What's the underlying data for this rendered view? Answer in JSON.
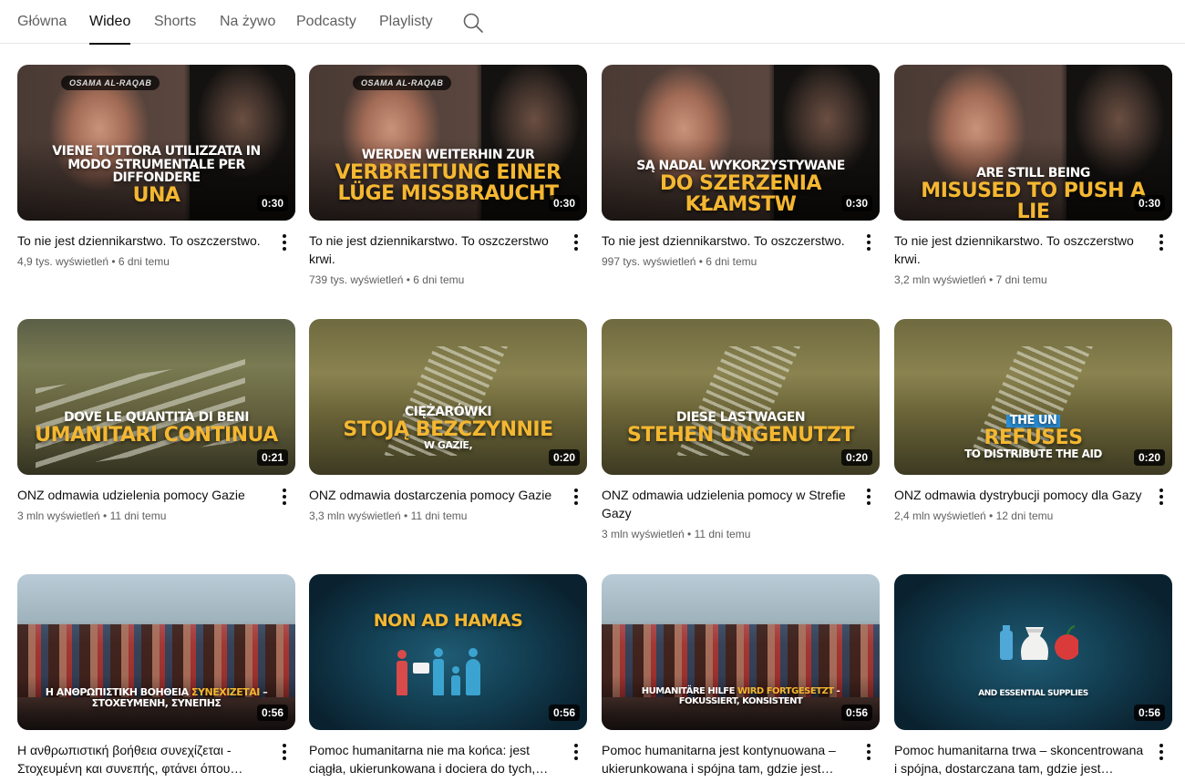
{
  "tabs": [
    {
      "label": "Główna",
      "active": false
    },
    {
      "label": "Wideo",
      "active": true
    },
    {
      "label": "Shorts",
      "active": false
    },
    {
      "label": "Na żywo",
      "active": false
    },
    {
      "label": "Podcasty",
      "active": false
    },
    {
      "label": "Playlisty",
      "active": false
    }
  ],
  "videos": [
    {
      "title": "To nie jest dziennikarstwo. To oszczerstwo.",
      "views": "4,9 tys. wyświetleń",
      "age": "6 dni temu",
      "duration": "0:30",
      "tag": "OSAMA AL-RAQAB",
      "cap_white": "VIENE TUTTORA UTILIZZATA IN MODO STRUMENTALE PER DIFFONDERE",
      "cap_yellow": "UNA"
    },
    {
      "title": "To nie jest dziennikarstwo. To oszczerstwo krwi.",
      "views": "739 tys. wyświetleń",
      "age": "6 dni temu",
      "duration": "0:30",
      "tag": "OSAMA AL-RAQAB",
      "cap_white": "WERDEN WEITERHIN ZUR",
      "cap_yellow": "VERBREITUNG EINER LÜGE MISSBRAUCHT"
    },
    {
      "title": "To nie jest dziennikarstwo. To oszczerstwo.",
      "views": "997 tys. wyświetleń",
      "age": "6 dni temu",
      "duration": "0:30",
      "cap_white": "SĄ NADAL WYKORZYSTYWANE",
      "cap_yellow": "DO SZERZENIA KŁAMSTW"
    },
    {
      "title": "To nie jest dziennikarstwo. To oszczerstwo krwi.",
      "views": "3,2 mln wyświetleń",
      "age": "7 dni temu",
      "duration": "0:30",
      "cap_white": "ARE STILL BEING",
      "cap_yellow": "MISUSED TO PUSH A LIE"
    },
    {
      "title": "ONZ odmawia udzielenia pomocy Gazie",
      "views": "3 mln wyświetleń",
      "age": "11 dni temu",
      "duration": "0:21",
      "cap_white": "DOVE LE QUANTITÀ DI BENI",
      "cap_yellow": "UMANITARI CONTINUA"
    },
    {
      "title": "ONZ odmawia dostarczenia pomocy Gazie",
      "views": "3,3 mln wyświetleń",
      "age": "11 dni temu",
      "duration": "0:20",
      "cap_white": "CIĘŻARÓWKI",
      "cap_yellow": "STOJĄ BEZCZYNNIE",
      "cap_white2": "W GAZIE,"
    },
    {
      "title": "ONZ odmawia udzielenia pomocy w Strefie Gazy",
      "views": "3 mln wyświetleń",
      "age": "11 dni temu",
      "duration": "0:20",
      "cap_white": "DIESE LASTWAGEN",
      "cap_yellow": "STEHEN UNGENUTZT"
    },
    {
      "title": "ONZ odmawia dystrybucji pomocy dla Gazy",
      "views": "2,4 mln wyświetleń",
      "age": "12 dni temu",
      "duration": "0:20",
      "cap_badge": "THE UN",
      "cap_yellow": "REFUSES",
      "cap_white2": "TO DISTRIBUTE THE AID"
    },
    {
      "title": "Η ανθρωπιστική βοήθεια συνεχίζεται - Στοχευμένη και συνεπής, φτάνει όπου…",
      "duration": "0:56",
      "cap_white": "Η ΑΝΘΡΩΠΙΣΤΙΚΗ ΒΟΗΘΕΙΑ",
      "cap_yellow_inline": "ΣΥΝΕΧΙΖΕΤΑΙ",
      "cap_white_tail": "–",
      "cap_white2": "ΣΤΟΧΕΥΜΕΝΗ, ΣΥΝΕΠΗΣ"
    },
    {
      "title": "Pomoc humanitarna nie ma końca: jest ciągła, ukierunkowana i dociera do tych,…",
      "duration": "0:56",
      "cap_yellow": "NON AD HAMAS"
    },
    {
      "title": "Pomoc humanitarna jest kontynuowana – ukierunkowana i spójna tam, gdzie jest…",
      "duration": "0:56",
      "cap_white": "HUMANITÄRE HILFE",
      "cap_yellow_inline": "WIRD FORTGESETZT",
      "cap_white_tail": "-",
      "cap_white2": "FOKUSSIERT, KONSISTENT"
    },
    {
      "title": "Pomoc humanitarna trwa – skoncentrowana i spójna, dostarczana tam, gdzie jest…",
      "duration": "0:56",
      "cap_white2": "AND ESSENTIAL SUPPLIES"
    }
  ]
}
